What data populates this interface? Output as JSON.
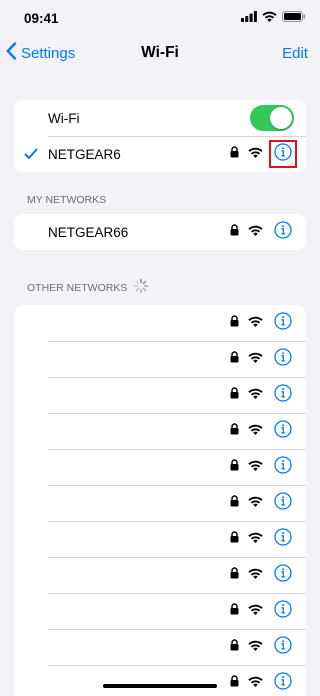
{
  "status_bar": {
    "time": "09:41"
  },
  "nav": {
    "back_label": "Settings",
    "title": "Wi-Fi",
    "edit_label": "Edit"
  },
  "wifi_group": {
    "toggle_label": "Wi-Fi",
    "toggle_on": true,
    "connected_network": "NETGEAR6"
  },
  "my_networks": {
    "header": "MY NETWORKS",
    "items": [
      {
        "name": "NETGEAR66"
      }
    ]
  },
  "other_networks": {
    "header": "OTHER NETWORKS",
    "count": 11
  },
  "colors": {
    "accent": "#007aff",
    "toggle_on": "#34c759",
    "highlight": "#e0101e"
  }
}
